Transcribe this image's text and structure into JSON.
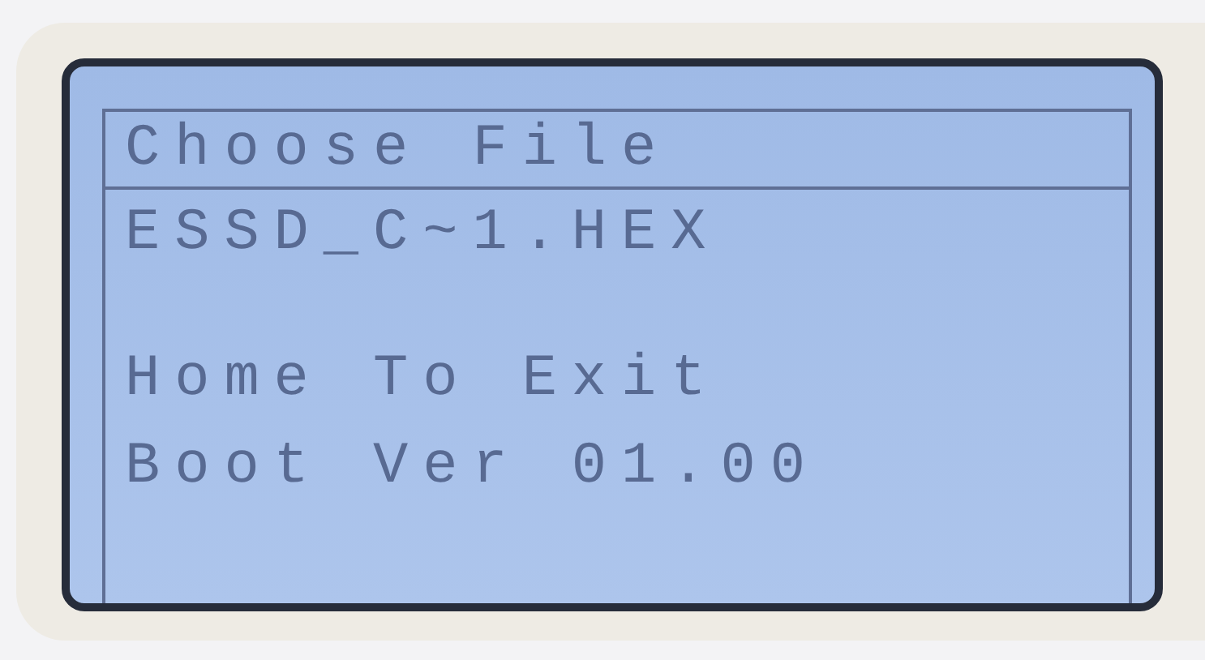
{
  "screen": {
    "title": "Choose File",
    "files": [
      "ESSD_C~1.HEX"
    ],
    "hint": "Home To Exit",
    "version": "Boot Ver 01.00"
  }
}
